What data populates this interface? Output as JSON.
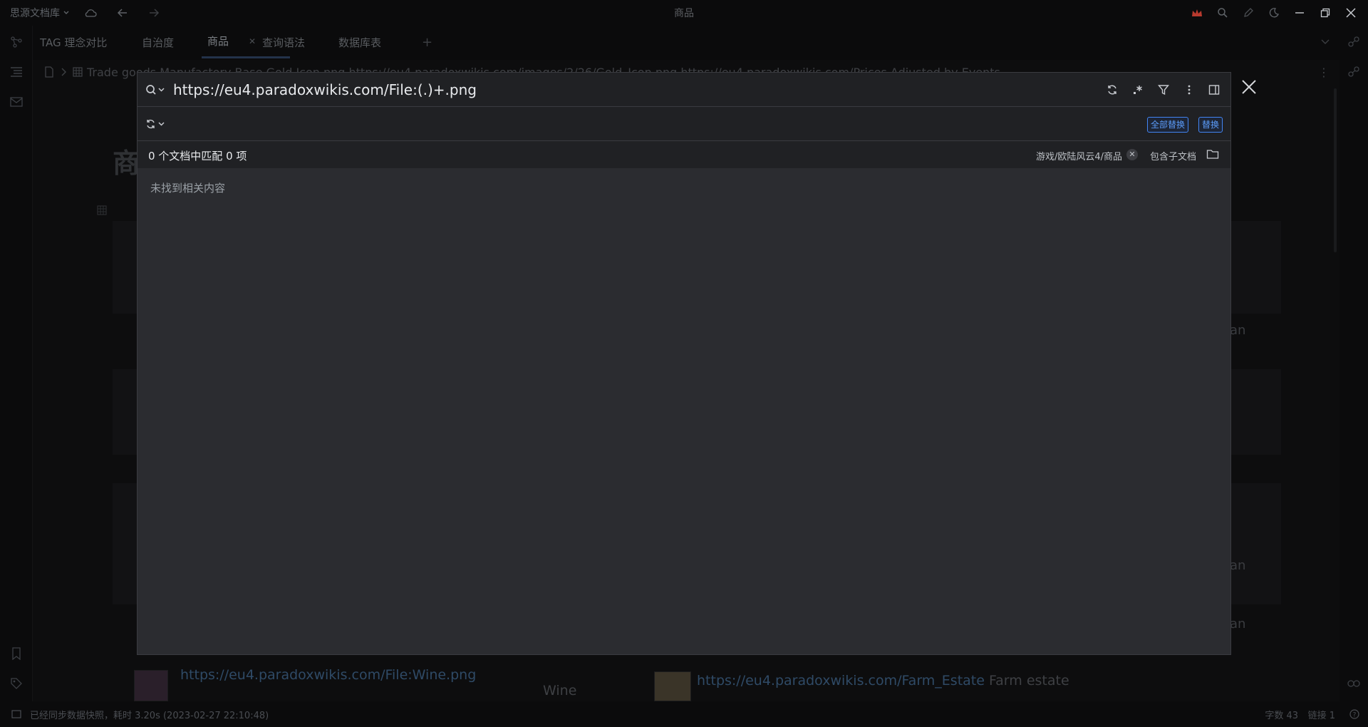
{
  "app": {
    "workspace": "思源文档库",
    "window_title": "商品"
  },
  "tabs": [
    {
      "label": "TAG 理念对比"
    },
    {
      "label": "自治度"
    },
    {
      "label": "商品",
      "active": true
    },
    {
      "label": "查询语法"
    },
    {
      "label": "数据库表"
    }
  ],
  "breadcrumb": {
    "text": "Trade goods Manufactory Base Gold Icon.png https://eu4.paradoxwikis.com/images/2/26/Gold_Icon.png https://eu4.paradoxwikis.com/Prices Adjusted by Events"
  },
  "background": {
    "heading_fragment": "商",
    "right_fragment": "an",
    "bottom_link_1": "https://eu4.paradoxwikis.com/File:Wine.png",
    "bottom_label": "Wine",
    "bottom_link_2": "https://eu4.paradoxwikis.com/Farm_Estate",
    "bottom_link_2_suffix": "Farm estate"
  },
  "search": {
    "query": "https://eu4.paradoxwikis.com/File:(.)+.png",
    "replace_value": "",
    "replace_all_label": "全部替换",
    "replace_label": "替换",
    "result_summary": "0 个文档中匹配 0 项",
    "scope_path": "游戏/欧陆风云4/商品",
    "include_subdocs_label": "包含子文档",
    "empty_message": "未找到相关内容"
  },
  "statusbar": {
    "sync_message": "已经同步数据快照，耗时 3.20s (2023-02-27 22:10:48)",
    "word_count": "字数 43",
    "link_count": "链接 1"
  },
  "colors": {
    "accent": "#4285f4",
    "dialog_bg": "#2b2c30",
    "dialog_header_bg": "#202124",
    "brand_red": "#c0392b"
  },
  "icons": {
    "search": "search-icon",
    "replace": "replace-icon",
    "refresh": "refresh-icon",
    "regex": "regex-icon",
    "filter": "filter-icon",
    "more": "more-icon",
    "panel": "panel-icon",
    "close": "close-icon",
    "folder": "folder-icon"
  }
}
